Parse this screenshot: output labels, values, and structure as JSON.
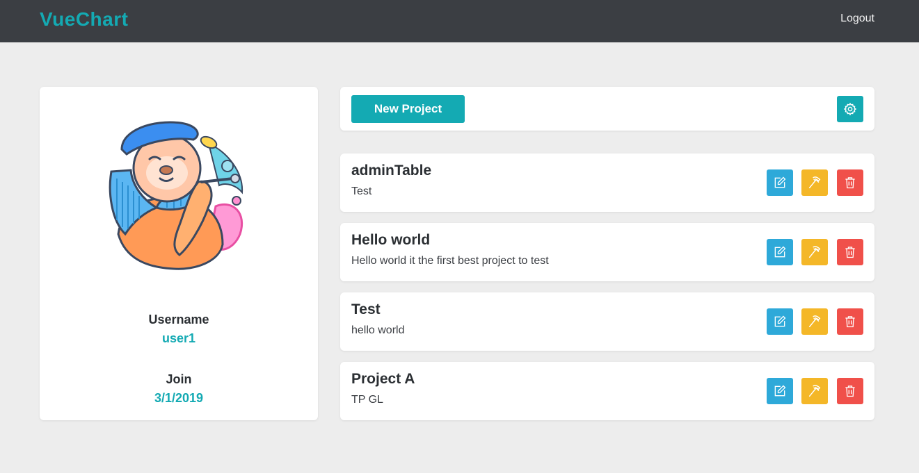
{
  "navbar": {
    "brand": "VueChart",
    "logout": "Logout"
  },
  "profile": {
    "username_label": "Username",
    "username": "user1",
    "join_label": "Join",
    "join_date": "3/1/2019"
  },
  "toolbar": {
    "new_project_label": "New Project",
    "settings_icon": "gear-icon"
  },
  "projects": [
    {
      "title": "adminTable",
      "description": "Test"
    },
    {
      "title": "Hello world",
      "description": "Hello world it the first best project to test"
    },
    {
      "title": "Test",
      "description": "hello world"
    },
    {
      "title": "Project A",
      "description": "TP GL"
    }
  ],
  "actions": {
    "edit_icon": "edit-icon",
    "build_icon": "hammer-icon",
    "delete_icon": "trash-icon"
  },
  "colors": {
    "accent": "#14aab3",
    "navbar": "#3b3e43",
    "edit": "#2ea9d9",
    "build": "#f4b728",
    "delete": "#f0504a",
    "background": "#ededed"
  }
}
